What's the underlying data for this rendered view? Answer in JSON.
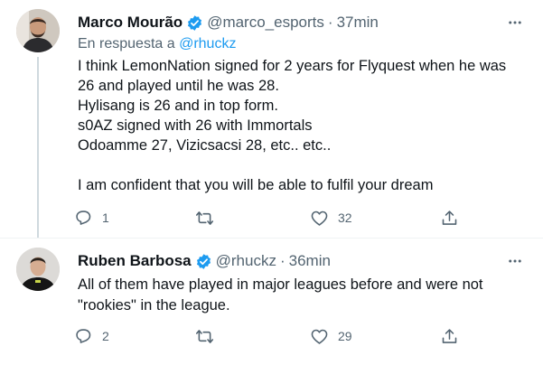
{
  "colors": {
    "text": "#0f1419",
    "secondary": "#536471",
    "accent": "#1d9bf0",
    "divider": "#eff3f4",
    "thread": "#cfd9de"
  },
  "tweets": [
    {
      "author_name": "Marco Mourão",
      "handle": "@marco_esports",
      "separator": "·",
      "time": "37min",
      "reply_prefix": "En respuesta a",
      "reply_mention": "@rhuckz",
      "lines": [
        "I think LemonNation signed for 2 years for Flyquest when he was",
        "26 and played until he was 28.",
        "Hylisang is 26 and in top form.",
        "s0AZ signed with 26 with Immortals",
        "Odoamme 27, Vizicsacsi 28, etc.. etc..",
        "",
        "I am confident that you will be able to fulfil your dream"
      ],
      "reply_count": "1",
      "retweet_count": "",
      "like_count": "32",
      "icons": [
        "reply-icon",
        "retweet-icon",
        "like-icon",
        "share-icon",
        "more-icon",
        "verified-badge-icon"
      ]
    },
    {
      "author_name": "Ruben Barbosa",
      "handle": "@rhuckz",
      "separator": "·",
      "time": "36min",
      "lines": [
        "All of them have played in major leagues before and were not",
        "\"rookies\" in the league."
      ],
      "reply_count": "2",
      "retweet_count": "",
      "like_count": "29",
      "icons": [
        "reply-icon",
        "retweet-icon",
        "like-icon",
        "share-icon",
        "more-icon",
        "verified-badge-icon"
      ]
    }
  ]
}
